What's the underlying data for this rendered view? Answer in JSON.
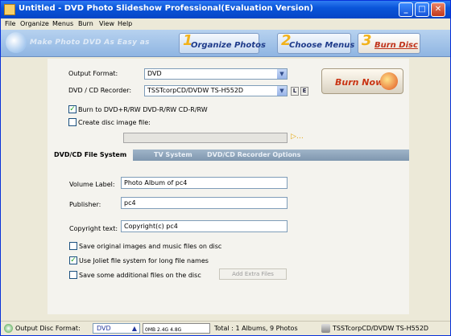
{
  "window": {
    "title": "Untitled - DVD Photo Slideshow Professional(Evaluation Version)"
  },
  "menu": [
    "File",
    "Organize",
    "Menus",
    "Burn",
    "View",
    "Help"
  ],
  "banner": {
    "slogan": "Make Photo DVD As Easy as",
    "steps": [
      {
        "num": "1",
        "label": "Organize Photos"
      },
      {
        "num": "2",
        "label": "Choose Menus"
      },
      {
        "num": "3",
        "label": "Burn Disc"
      }
    ]
  },
  "output": {
    "format_label": "Output Format:",
    "format_value": "DVD",
    "recorder_label": "DVD / CD Recorder:",
    "recorder_value": "TSSTcorpCD/DVDW TS-H552D",
    "l_btn": "L",
    "e_btn": "E",
    "burn_support": "Burn to DVD+R/RW DVD-R/RW  CD-R/RW",
    "create_image": "Create disc image file:",
    "burn_now": "Burn Now!"
  },
  "tabs": [
    "DVD/CD File System",
    "TV System",
    "DVD/CD Recorder Options"
  ],
  "fs": {
    "volume_label": "Volume Label:",
    "volume_value": "Photo Album of pc4",
    "publisher_label": "Publisher:",
    "publisher_value": "pc4",
    "copyright_label": "Copyright text:",
    "copyright_value": "Copyright(c) pc4",
    "opt1": "Save original images and music files on disc",
    "opt2": "Use Joliet file system for long file names",
    "opt3": "Save some additional files on the disc",
    "extra_btn": "Add Extra Files"
  },
  "status": {
    "format_label": "Output Disc Format:",
    "format_value": "DVD",
    "meter": "0MB   2.4G  4.8G",
    "total": "Total : 1 Albums, 9 Photos",
    "drive": "TSSTcorpCD/DVDW TS-H552D"
  },
  "checks": {
    "burn_support": true,
    "create_image": false,
    "opt1": false,
    "opt2": true,
    "opt3": false
  }
}
